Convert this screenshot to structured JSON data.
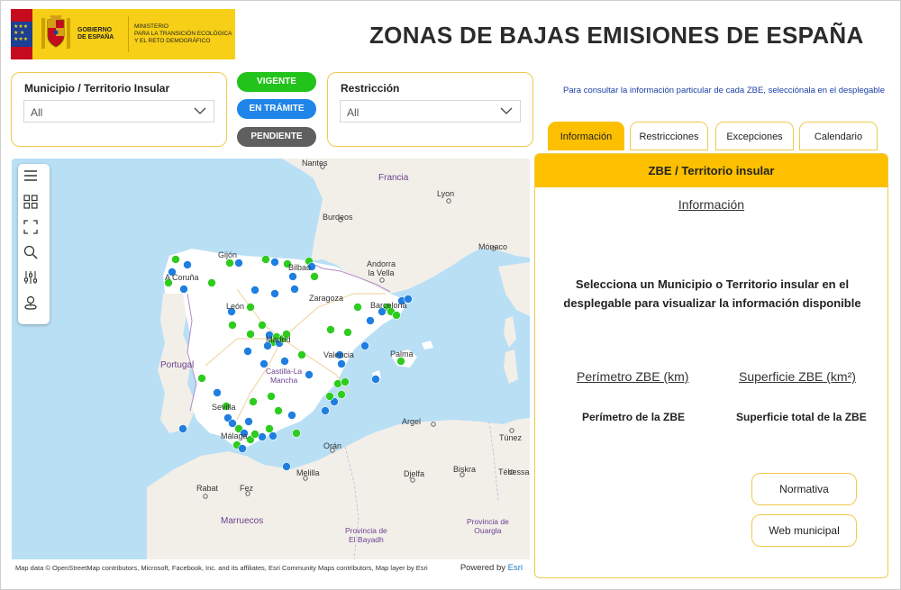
{
  "header": {
    "title": "ZONAS DE BAJAS EMISIONES DE ESPAÑA",
    "gov_label_1": "GOBIERNO",
    "gov_label_2": "DE ESPAÑA",
    "ministry_1": "MINISTERIO",
    "ministry_2": "PARA LA TRANSICIÓN ECOLÓGICA",
    "ministry_3": "Y EL RETO DEMOGRÁFICO"
  },
  "filters": {
    "municipio_label": "Municipio / Territorio Insular",
    "municipio_value": "All",
    "restriccion_label": "Restricción",
    "restriccion_value": "All"
  },
  "status_buttons": [
    {
      "label": "VIGENTE",
      "color": "#22c31b"
    },
    {
      "label": "EN TRÁMITE",
      "color": "#1f85e8"
    },
    {
      "label": "PENDIENTE",
      "color": "#5f5f5f"
    }
  ],
  "hint": "Para consultar la información particular de cada ZBE, selecciónala en el desplegable",
  "tabs": [
    {
      "label": "Información",
      "active": true
    },
    {
      "label": "Restricciones",
      "active": false
    },
    {
      "label": "Excepciones",
      "active": false
    },
    {
      "label": "Calendario",
      "active": false
    }
  ],
  "panel": {
    "header": "ZBE / Territorio insular",
    "subtitle": "Información",
    "message": "Selecciona un Municipio o Territorio insular en el desplegable para visualizar la información disponible",
    "perimeter_label": "Perímetro ZBE (km)",
    "surface_label": "Superficie ZBE (km²)",
    "perimeter_value": "Perímetro de la ZBE",
    "surface_value": "Superficie total de la ZBE",
    "normativa": "Normativa",
    "web": "Web municipal"
  },
  "map": {
    "labels": {
      "nantes": "Nantes",
      "francia": "Francia",
      "lyon": "Lyon",
      "burdeos": "Burdeos",
      "andorra": "Andorra\nla Vella",
      "monaco": "Mónaco",
      "gijon": "Gijón",
      "bilbao": "Bilbao",
      "acoruna": "A Coruña",
      "zaragoza": "Zaragoza",
      "leon": "León",
      "barcelona": "Barcelona",
      "portugal": "Portugal",
      "madrid": "Madrid",
      "castilla": "Castilla-La\nMancha",
      "valencia": "Valencia",
      "palma": "Palma",
      "sevilla": "Sevilla",
      "malaga": "Málaga",
      "argel": "Argel",
      "tunez": "Túnez",
      "oran": "Orán",
      "melilla": "Melilla",
      "rabat": "Rabat",
      "fez": "Fez",
      "djelfa": "Djelfa",
      "biskra": "Biskra",
      "tebessa": "Tébessa",
      "marruecos": "Marruecos",
      "bayadh": "Provincia de\nEl Bayadh",
      "ouargla": "Provincia de\nOuargla"
    },
    "colors": {
      "vigente": "#2ecc1f",
      "tramite": "#1f7fe0",
      "land": "#f2efe9",
      "sea": "#b9dff5",
      "spain": "#ffffff"
    },
    "attribution": "Map data © OpenStreetMap contributors, Microsoft, Facebook, Inc. and its affiliates, Esri Community Maps contributors, Map layer by Esri",
    "powered_by": "Powered by",
    "esri": "Esri"
  }
}
